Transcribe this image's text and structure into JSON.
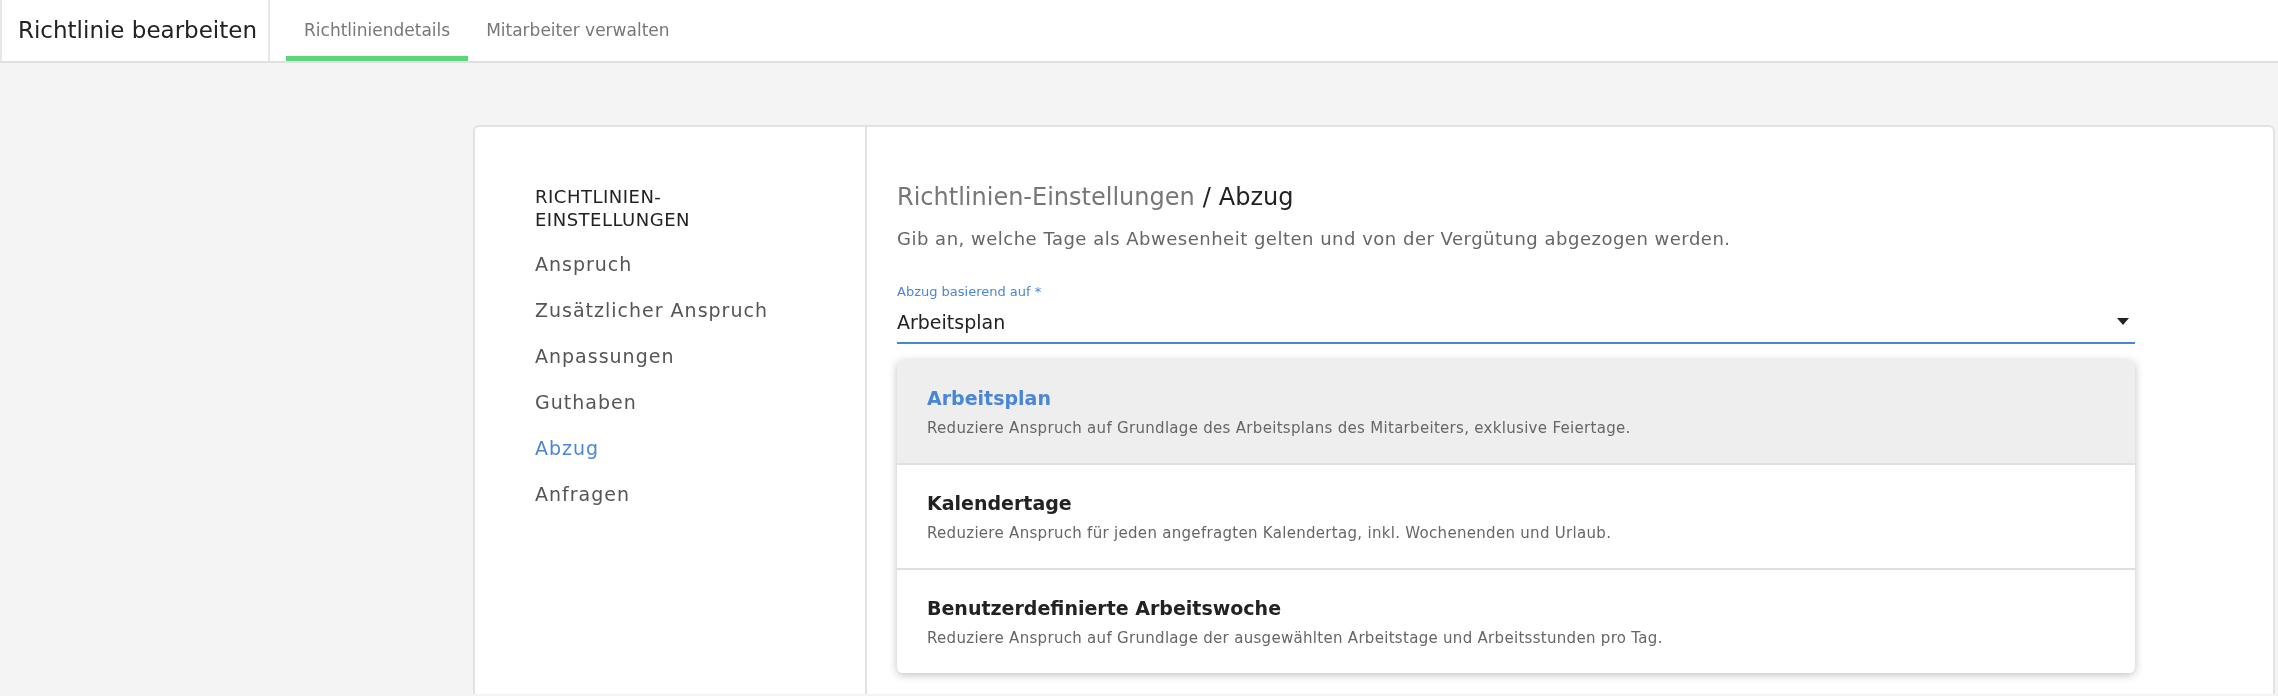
{
  "header": {
    "title": "Richtlinie bearbeiten"
  },
  "tabs": [
    {
      "label": "Richtliniendetails",
      "selected": true
    },
    {
      "label": "Mitarbeiter verwalten",
      "selected": false
    }
  ],
  "sidebar": {
    "heading": "RICHTLINIEN-EINSTELLUNGEN",
    "items": [
      {
        "label": "Anspruch",
        "selected": false
      },
      {
        "label": "Zusätzlicher Anspruch",
        "selected": false
      },
      {
        "label": "Anpassungen",
        "selected": false
      },
      {
        "label": "Guthaben",
        "selected": false
      },
      {
        "label": "Abzug",
        "selected": true
      },
      {
        "label": "Anfragen",
        "selected": false
      }
    ]
  },
  "content": {
    "breadcrumb_parent": "Richtlinien-Einstellungen",
    "breadcrumb_separator": "/",
    "breadcrumb_current": "Abzug",
    "description": "Gib an, welche Tage als Abwesenheit gelten und von der Vergütung abgezogen werden.",
    "select": {
      "label": "Abzug basierend auf *",
      "value": "Arbeitsplan",
      "expanded": true,
      "options": [
        {
          "title": "Arbeitsplan",
          "description": "Reduziere Anspruch auf Grundlage des Arbeitsplans des Mitarbeiters, exklusive Feiertage.",
          "selected": true
        },
        {
          "title": "Kalendertage",
          "description": "Reduziere Anspruch für jeden angefragten Kalendertag, inkl. Wochenenden und Urlaub.",
          "selected": false
        },
        {
          "title": "Benutzerdefinierte Arbeitswoche",
          "description": "Reduziere Anspruch auf Grundlage der ausgewählten Arbeitstage und Arbeitsstunden pro Tag.",
          "selected": false
        }
      ]
    }
  }
}
